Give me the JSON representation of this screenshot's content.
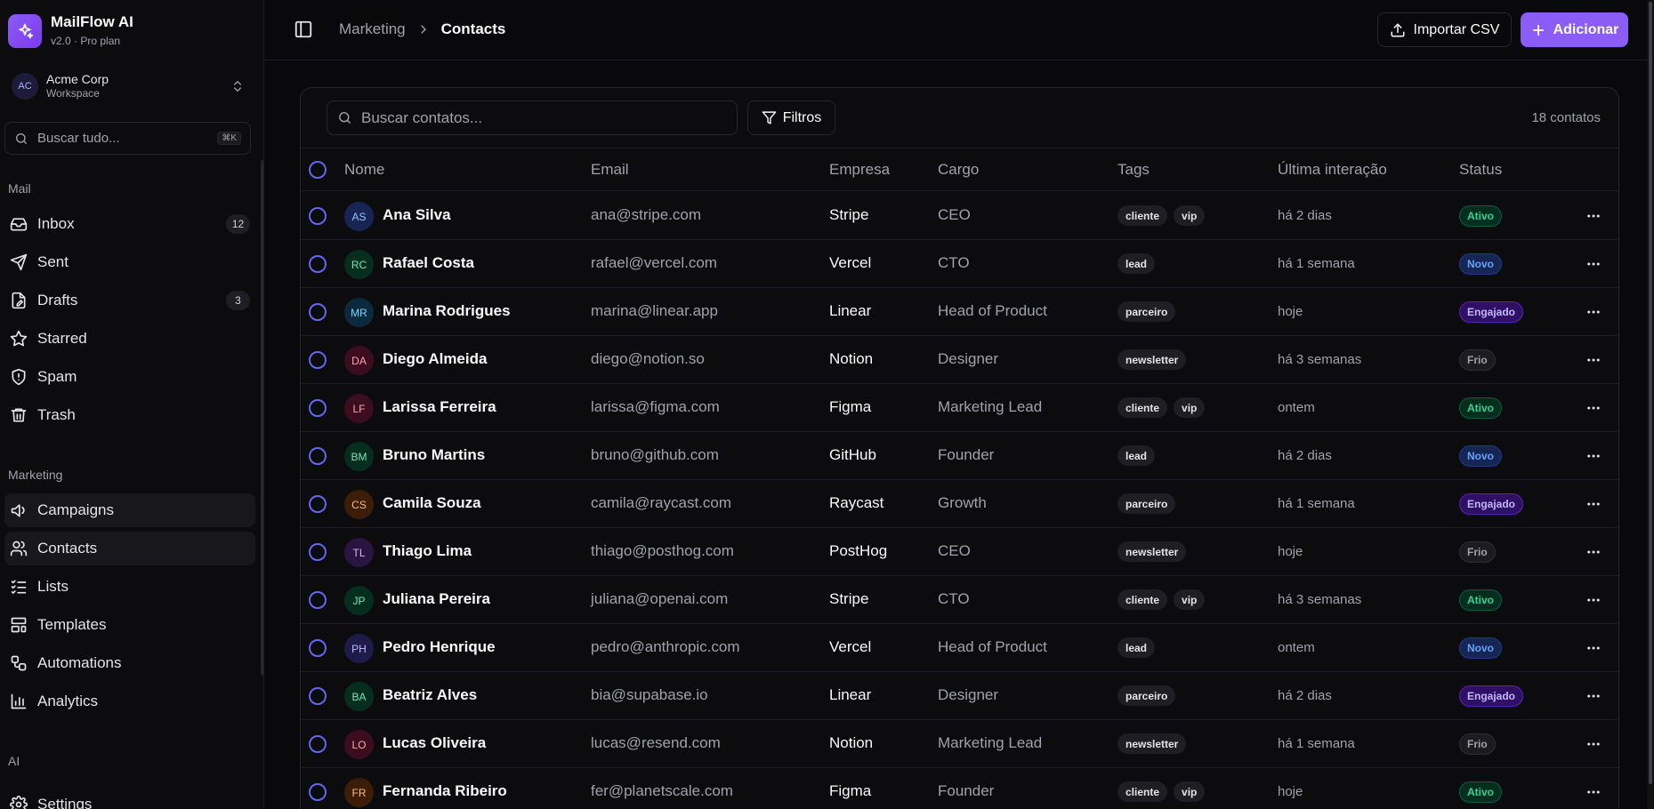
{
  "brand": {
    "name": "MailFlow AI",
    "version": "v2.0 · Pro plan"
  },
  "workspace": {
    "initials": "AC",
    "name": "Acme Corp",
    "label": "Workspace"
  },
  "sidebar_search": {
    "placeholder": "Buscar tudo...",
    "shortcut": "⌘K"
  },
  "sections": {
    "mail": "Mail",
    "marketing": "Marketing",
    "ai": "AI"
  },
  "mail_items": [
    {
      "label": "Inbox",
      "icon": "inbox-icon",
      "badge": "12"
    },
    {
      "label": "Sent",
      "icon": "send-icon"
    },
    {
      "label": "Drafts",
      "icon": "draft-icon",
      "badge": "3"
    },
    {
      "label": "Starred",
      "icon": "star-icon"
    },
    {
      "label": "Spam",
      "icon": "shield-alert-icon"
    },
    {
      "label": "Trash",
      "icon": "trash-icon"
    }
  ],
  "marketing_items": [
    {
      "label": "Campaigns",
      "icon": "megaphone-icon"
    },
    {
      "label": "Contacts",
      "icon": "users-icon"
    },
    {
      "label": "Lists",
      "icon": "list-icon"
    },
    {
      "label": "Templates",
      "icon": "template-icon"
    },
    {
      "label": "Automations",
      "icon": "workflow-icon"
    },
    {
      "label": "Analytics",
      "icon": "bar-chart-icon"
    }
  ],
  "settings": {
    "label": "Settings",
    "icon": "gear-icon"
  },
  "header": {
    "breadcrumb_parent": "Marketing",
    "breadcrumb_current": "Contacts",
    "import_label": "Importar CSV",
    "add_label": "Adicionar"
  },
  "toolbar": {
    "search_placeholder": "Buscar contatos...",
    "filter_label": "Filtros",
    "count": "18 contatos"
  },
  "columns": [
    "Nome",
    "Email",
    "Empresa",
    "Cargo",
    "Tags",
    "Última interação",
    "Status"
  ],
  "colors": {
    "accent": "#8b5cf6",
    "ativo": "#34d399",
    "novo": "#60a5fa",
    "engajado": "#c4b5fd",
    "frio": "#a1a1aa"
  },
  "contacts": [
    {
      "initials": "AS",
      "name": "Ana Silva",
      "email": "ana@stripe.com",
      "company": "Stripe",
      "role": "CEO",
      "tags": [
        "cliente",
        "vip"
      ],
      "last": "há 2 dias",
      "status": "Ativo",
      "status_key": "ativo",
      "avatar_bg": "#172554",
      "avatar_fg": "#93c5fd"
    },
    {
      "initials": "RC",
      "name": "Rafael Costa",
      "email": "rafael@vercel.com",
      "company": "Vercel",
      "role": "CTO",
      "tags": [
        "lead"
      ],
      "last": "há 1 semana",
      "status": "Novo",
      "status_key": "novo",
      "avatar_bg": "#052e1f",
      "avatar_fg": "#6ee7b7"
    },
    {
      "initials": "MR",
      "name": "Marina Rodrigues",
      "email": "marina@linear.app",
      "company": "Linear",
      "role": "Head of Product",
      "tags": [
        "parceiro"
      ],
      "last": "hoje",
      "status": "Engajado",
      "status_key": "engajado",
      "avatar_bg": "#0c2a3d",
      "avatar_fg": "#7dd3fc"
    },
    {
      "initials": "DA",
      "name": "Diego Almeida",
      "email": "diego@notion.so",
      "company": "Notion",
      "role": "Designer",
      "tags": [
        "newsletter"
      ],
      "last": "há 3 semanas",
      "status": "Frio",
      "status_key": "frio",
      "avatar_bg": "#3b0d1f",
      "avatar_fg": "#fda4af"
    },
    {
      "initials": "LF",
      "name": "Larissa Ferreira",
      "email": "larissa@figma.com",
      "company": "Figma",
      "role": "Marketing Lead",
      "tags": [
        "cliente",
        "vip"
      ],
      "last": "ontem",
      "status": "Ativo",
      "status_key": "ativo",
      "avatar_bg": "#3b0d1f",
      "avatar_fg": "#fda4af"
    },
    {
      "initials": "BM",
      "name": "Bruno Martins",
      "email": "bruno@github.com",
      "company": "GitHub",
      "role": "Founder",
      "tags": [
        "lead"
      ],
      "last": "há 2 dias",
      "status": "Novo",
      "status_key": "novo",
      "avatar_bg": "#052e1f",
      "avatar_fg": "#6ee7b7"
    },
    {
      "initials": "CS",
      "name": "Camila Souza",
      "email": "camila@raycast.com",
      "company": "Raycast",
      "role": "Growth",
      "tags": [
        "parceiro"
      ],
      "last": "há 1 semana",
      "status": "Engajado",
      "status_key": "engajado",
      "avatar_bg": "#3b1d08",
      "avatar_fg": "#fdba74"
    },
    {
      "initials": "TL",
      "name": "Thiago Lima",
      "email": "thiago@posthog.com",
      "company": "PostHog",
      "role": "CEO",
      "tags": [
        "newsletter"
      ],
      "last": "hoje",
      "status": "Frio",
      "status_key": "frio",
      "avatar_bg": "#2a1540",
      "avatar_fg": "#d8b4fe"
    },
    {
      "initials": "JP",
      "name": "Juliana Pereira",
      "email": "juliana@openai.com",
      "company": "Stripe",
      "role": "CTO",
      "tags": [
        "cliente",
        "vip"
      ],
      "last": "há 3 semanas",
      "status": "Ativo",
      "status_key": "ativo",
      "avatar_bg": "#052e1f",
      "avatar_fg": "#6ee7b7"
    },
    {
      "initials": "PH",
      "name": "Pedro Henrique",
      "email": "pedro@anthropic.com",
      "company": "Vercel",
      "role": "Head of Product",
      "tags": [
        "lead"
      ],
      "last": "ontem",
      "status": "Novo",
      "status_key": "novo",
      "avatar_bg": "#1e1b4b",
      "avatar_fg": "#c4b5fd"
    },
    {
      "initials": "BA",
      "name": "Beatriz Alves",
      "email": "bia@supabase.io",
      "company": "Linear",
      "role": "Designer",
      "tags": [
        "parceiro"
      ],
      "last": "há 2 dias",
      "status": "Engajado",
      "status_key": "engajado",
      "avatar_bg": "#052e1f",
      "avatar_fg": "#6ee7b7"
    },
    {
      "initials": "LO",
      "name": "Lucas Oliveira",
      "email": "lucas@resend.com",
      "company": "Notion",
      "role": "Marketing Lead",
      "tags": [
        "newsletter"
      ],
      "last": "há 1 semana",
      "status": "Frio",
      "status_key": "frio",
      "avatar_bg": "#3b0d1f",
      "avatar_fg": "#fda4af"
    },
    {
      "initials": "FR",
      "name": "Fernanda Ribeiro",
      "email": "fer@planetscale.com",
      "company": "Figma",
      "role": "Founder",
      "tags": [
        "cliente",
        "vip"
      ],
      "last": "hoje",
      "status": "Ativo",
      "status_key": "ativo",
      "avatar_bg": "#3b1d08",
      "avatar_fg": "#fdba74"
    }
  ]
}
